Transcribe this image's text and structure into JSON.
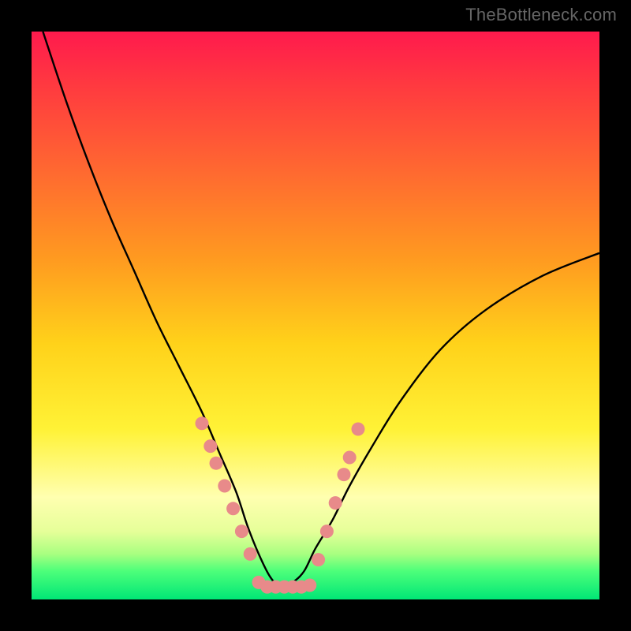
{
  "watermark": "TheBottleneck.com",
  "colors": {
    "frame": "#000000",
    "curve": "#000000",
    "dot_fill": "#e88a8a",
    "dot_stroke": "#c95f5f",
    "gradient_stops": [
      {
        "pct": 0,
        "hex": "#ff1a4d"
      },
      {
        "pct": 10,
        "hex": "#ff3b3f"
      },
      {
        "pct": 25,
        "hex": "#ff6a30"
      },
      {
        "pct": 40,
        "hex": "#ff9a20"
      },
      {
        "pct": 55,
        "hex": "#ffd21a"
      },
      {
        "pct": 70,
        "hex": "#fff236"
      },
      {
        "pct": 82,
        "hex": "#ffffb0"
      },
      {
        "pct": 88,
        "hex": "#e6ff99"
      },
      {
        "pct": 92,
        "hex": "#a8ff80"
      },
      {
        "pct": 95,
        "hex": "#4dff7a"
      },
      {
        "pct": 100,
        "hex": "#00e676"
      }
    ]
  },
  "chart_data": {
    "type": "line",
    "title": "",
    "xlabel": "",
    "ylabel": "",
    "xlim": [
      0,
      100
    ],
    "ylim": [
      0,
      100
    ],
    "note": "x is horizontal position (0=left edge of plot, 100=right). y is bottleneck percentage (0=bottom/green/optimal, 100=top/red/severe). Curve is a V-shaped bottleneck profile with minimum near x≈44.",
    "series": [
      {
        "name": "bottleneck-curve",
        "x": [
          2,
          6,
          10,
          14,
          18,
          22,
          26,
          30,
          33,
          36,
          38,
          40,
          42,
          44,
          46,
          48,
          50,
          53,
          56,
          60,
          65,
          72,
          80,
          90,
          100
        ],
        "y": [
          100,
          88,
          77,
          67,
          58,
          49,
          41,
          33,
          26,
          19,
          13,
          8,
          4,
          2,
          3,
          5,
          9,
          14,
          20,
          27,
          35,
          44,
          51,
          57,
          61
        ]
      }
    ],
    "markers": {
      "name": "highlight-dots",
      "note": "salmon circular markers along lower portion of V and flat bottom",
      "points": [
        {
          "x": 30.0,
          "y": 31
        },
        {
          "x": 31.5,
          "y": 27
        },
        {
          "x": 32.5,
          "y": 24
        },
        {
          "x": 34.0,
          "y": 20
        },
        {
          "x": 35.5,
          "y": 16
        },
        {
          "x": 37.0,
          "y": 12
        },
        {
          "x": 38.5,
          "y": 8
        },
        {
          "x": 40.0,
          "y": 3
        },
        {
          "x": 41.5,
          "y": 2.2
        },
        {
          "x": 43.0,
          "y": 2.2
        },
        {
          "x": 44.5,
          "y": 2.2
        },
        {
          "x": 46.0,
          "y": 2.2
        },
        {
          "x": 47.5,
          "y": 2.2
        },
        {
          "x": 49.0,
          "y": 2.5
        },
        {
          "x": 50.5,
          "y": 7
        },
        {
          "x": 52.0,
          "y": 12
        },
        {
          "x": 53.5,
          "y": 17
        },
        {
          "x": 55.0,
          "y": 22
        },
        {
          "x": 56.0,
          "y": 25
        },
        {
          "x": 57.5,
          "y": 30
        }
      ]
    }
  }
}
